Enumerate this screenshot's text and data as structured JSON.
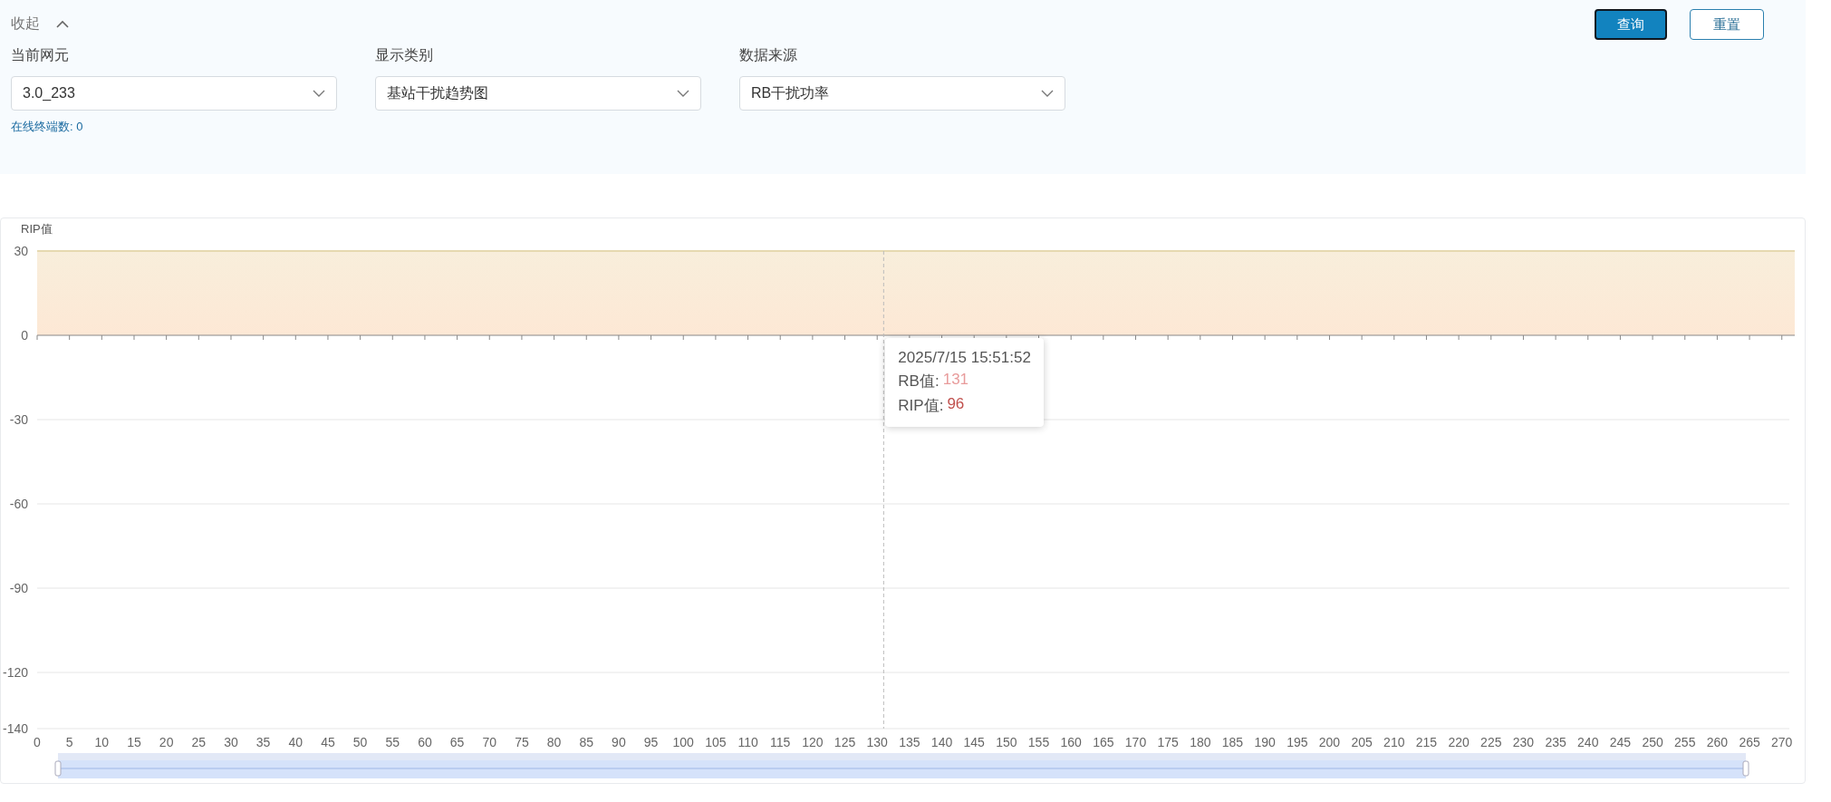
{
  "filter_panel": {
    "collapse_toggle": "收起",
    "expanded": true,
    "fields": [
      {
        "label": "当前网元",
        "value": "3.0_233"
      },
      {
        "label": "显示类别",
        "value": "基站干扰趋势图"
      },
      {
        "label": "数据来源",
        "value": "RB干扰功率"
      }
    ],
    "online_terminals": "在线终端数: 0",
    "buttons": [
      {
        "label": "查询",
        "kind": "primary"
      },
      {
        "label": "重置",
        "kind": "secondary"
      }
    ]
  },
  "chart": {
    "chart_data": {
      "type": "area",
      "ylabel": "RIP值",
      "x": [
        0,
        272
      ],
      "series": [
        {
          "color": "#e6d9b0",
          "values": [
            30,
            30
          ]
        }
      ],
      "grid": true,
      "xlim": [
        0,
        272
      ],
      "ylim": [
        -140,
        30
      ],
      "xticks": [
        0,
        5,
        10,
        15,
        20,
        25,
        30,
        35,
        40,
        45,
        50,
        55,
        60,
        65,
        70,
        75,
        80,
        85,
        90,
        95,
        100,
        105,
        110,
        115,
        120,
        125,
        130,
        135,
        140,
        145,
        150,
        155,
        160,
        165,
        170,
        175,
        180,
        185,
        190,
        195,
        200,
        205,
        210,
        215,
        220,
        225,
        230,
        235,
        240,
        245,
        250,
        255,
        260,
        265,
        270
      ],
      "yticks": [
        30,
        0,
        -30,
        -60,
        -90,
        -120,
        -140
      ],
      "ref_lines": [
        {
          "axis": "x",
          "value": 131
        }
      ]
    },
    "tooltip": {
      "title": "2025/7/15 15:51:52",
      "rows": [
        {
          "label": "RB值:",
          "value": "131",
          "color": "#e89b9b"
        },
        {
          "label": "RIP值:",
          "value": "96",
          "color": "#c0504d"
        }
      ]
    }
  }
}
